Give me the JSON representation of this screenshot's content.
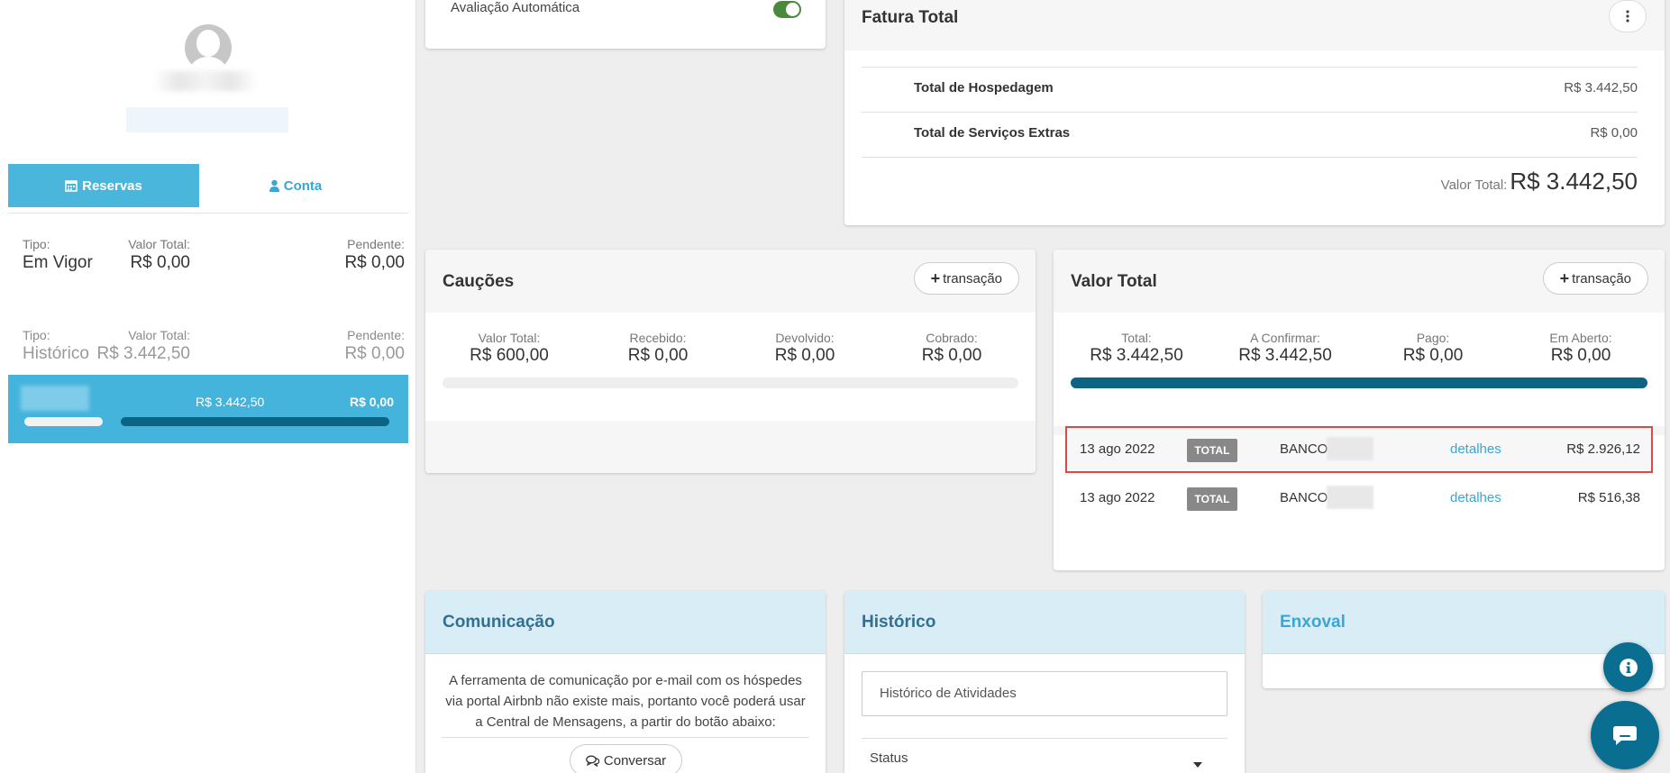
{
  "sidebar": {
    "tabs": {
      "reservas": "Reservas",
      "conta": "Conta"
    },
    "summary": [
      {
        "tipo_label": "Tipo:",
        "tipo_value": "Em Vigor",
        "total_label": "Valor Total:",
        "total_value": "R$ 0,00",
        "pend_label": "Pendente:",
        "pend_value": "R$ 0,00"
      },
      {
        "tipo_label": "Tipo:",
        "tipo_value": "Histórico",
        "total_label": "Valor Total:",
        "total_value": "R$ 3.442,50",
        "pend_label": "Pendente:",
        "pend_value": "R$ 0,00"
      }
    ],
    "selected_reservation": {
      "total": "R$ 3.442,50",
      "pending": "R$ 0,00"
    }
  },
  "avaliacao": {
    "label": "Avaliação Automática",
    "enabled": true
  },
  "fatura": {
    "title": "Fatura Total",
    "rows": [
      {
        "label": "Total de Hospedagem",
        "value": "R$ 3.442,50"
      },
      {
        "label": "Total de Serviços Extras",
        "value": "R$ 0,00"
      }
    ],
    "total_label": "Valor Total:",
    "total_value": "R$ 3.442,50"
  },
  "caucoes": {
    "title": "Cauções",
    "button": "transação",
    "metrics": [
      {
        "label": "Valor Total:",
        "value": "R$ 600,00"
      },
      {
        "label": "Recebido:",
        "value": "R$ 0,00"
      },
      {
        "label": "Devolvido:",
        "value": "R$ 0,00"
      },
      {
        "label": "Cobrado:",
        "value": "R$ 0,00"
      }
    ],
    "progress": 0
  },
  "valor_total": {
    "title": "Valor Total",
    "button": "transação",
    "metrics": [
      {
        "label": "Total:",
        "value": "R$ 3.442,50"
      },
      {
        "label": "A Confirmar:",
        "value": "R$ 3.442,50"
      },
      {
        "label": "Pago:",
        "value": "R$ 0,00"
      },
      {
        "label": "Em Aberto:",
        "value": "R$ 0,00"
      }
    ],
    "progress": 1,
    "transactions": [
      {
        "date": "13 ago 2022",
        "badge": "TOTAL",
        "bank": "BANCO",
        "link": "detalhes",
        "amount": "R$ 2.926,12"
      },
      {
        "date": "13 ago 2022",
        "badge": "TOTAL",
        "bank": "BANCO",
        "link": "detalhes",
        "amount": "R$ 516,38"
      }
    ]
  },
  "comunicacao": {
    "title": "Comunicação",
    "text": "A ferramenta de comunicação por e-mail com os hóspedes via portal Airbnb não existe mais, portanto você poderá usar a Central de Mensagens, a partir do botão abaixo:",
    "button": "Conversar"
  },
  "historico": {
    "title": "Histórico",
    "input_value": "Histórico de Atividades",
    "status_label": "Status"
  },
  "enxoval": {
    "title": "Enxoval"
  },
  "colors": {
    "accent": "#4ab6dc",
    "dark_blue": "#0c6384",
    "highlight": "#e04848",
    "toggle_on": "#4a8a3c"
  },
  "icons": [
    "user-avatar-icon",
    "calendar-icon",
    "user-icon",
    "kebab-menu-icon",
    "plus-icon",
    "chat-bubbles-icon",
    "caret-down-icon",
    "info-icon",
    "chat-icon"
  ]
}
